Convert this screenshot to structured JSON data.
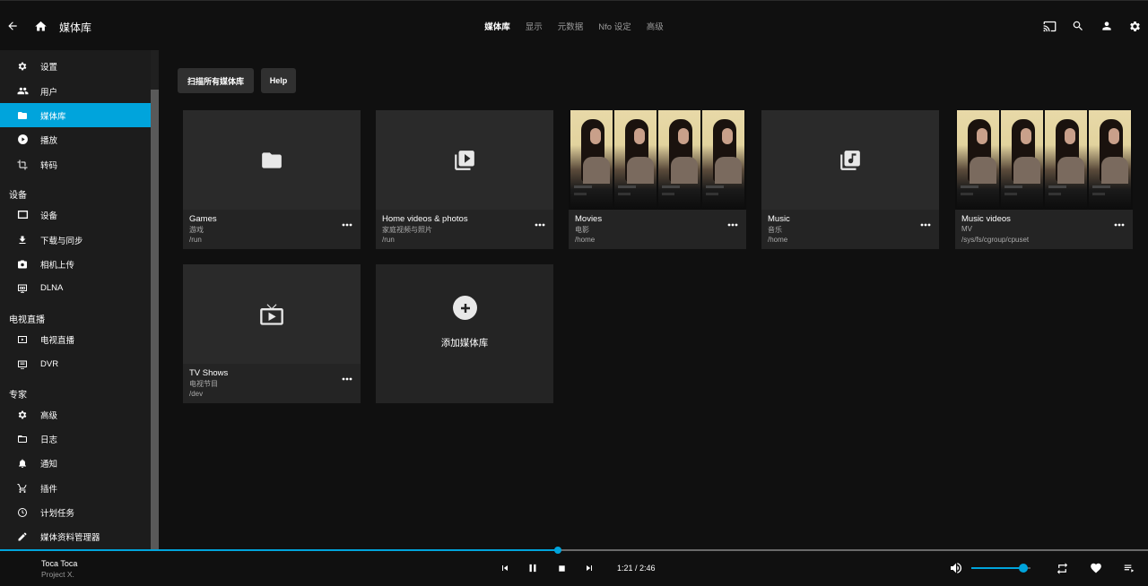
{
  "header": {
    "title": "媒体库",
    "tabs": [
      {
        "label": "媒体库",
        "active": true
      },
      {
        "label": "显示",
        "active": false
      },
      {
        "label": "元数据",
        "active": false
      },
      {
        "label": "Nfo 设定",
        "active": false
      },
      {
        "label": "高级",
        "active": false
      }
    ],
    "icons": [
      "back-arrow-icon",
      "home-icon",
      "cast-icon",
      "search-icon",
      "user-icon",
      "settings-icon"
    ]
  },
  "sidebar": {
    "groups": [
      {
        "header": "",
        "items": [
          {
            "label": "设置",
            "icon": "gear-icon",
            "active": false
          },
          {
            "label": "用户",
            "icon": "people-icon",
            "active": false
          },
          {
            "label": "媒体库",
            "icon": "folder-icon",
            "active": true
          },
          {
            "label": "播放",
            "icon": "play-circle-icon",
            "active": false
          },
          {
            "label": "转码",
            "icon": "transcode-icon",
            "active": false
          }
        ]
      },
      {
        "header": "设备",
        "items": [
          {
            "label": "设备",
            "icon": "device-icon",
            "active": false
          },
          {
            "label": "下载与同步",
            "icon": "download-icon",
            "active": false
          },
          {
            "label": "相机上传",
            "icon": "camera-icon",
            "active": false
          },
          {
            "label": "DLNA",
            "icon": "dlna-icon",
            "active": false
          }
        ]
      },
      {
        "header": "电视直播",
        "items": [
          {
            "label": "电视直播",
            "icon": "live-tv-icon",
            "active": false
          },
          {
            "label": "DVR",
            "icon": "dvr-icon",
            "active": false
          }
        ]
      },
      {
        "header": "专家",
        "items": [
          {
            "label": "高级",
            "icon": "gear-icon",
            "active": false
          },
          {
            "label": "日志",
            "icon": "folder-outline-icon",
            "active": false
          },
          {
            "label": "通知",
            "icon": "bell-icon",
            "active": false
          },
          {
            "label": "插件",
            "icon": "cart-icon",
            "active": false
          },
          {
            "label": "计划任务",
            "icon": "clock-icon",
            "active": false
          },
          {
            "label": "媒体资料管理器",
            "icon": "pencil-icon",
            "active": false
          }
        ]
      }
    ]
  },
  "actions": {
    "scan_label": "扫描所有媒体库",
    "help_label": "Help"
  },
  "libraries": [
    {
      "title": "Games",
      "type": "游戏",
      "path": "/run",
      "image": "folder-icon"
    },
    {
      "title": "Home videos & photos",
      "type": "家庭视频与照片",
      "path": "/run",
      "image": "video-library-icon"
    },
    {
      "title": "Movies",
      "type": "电影",
      "path": "/home",
      "image": "photo-strip"
    },
    {
      "title": "Music",
      "type": "音乐",
      "path": "/home",
      "image": "music-library-icon"
    },
    {
      "title": "Music videos",
      "type": "MV",
      "path": "/sys/fs/cgroup/cpuset",
      "image": "photo-strip"
    },
    {
      "title": "TV Shows",
      "type": "电视节目",
      "path": "/dev",
      "image": "tv-icon"
    }
  ],
  "add_library_label": "添加媒体库",
  "player": {
    "title": "Toca Toca",
    "artist": "Project X.",
    "time": "1:21 / 2:46",
    "progress": 0.486,
    "volume": 0.88,
    "accent": "#00a4dc"
  }
}
